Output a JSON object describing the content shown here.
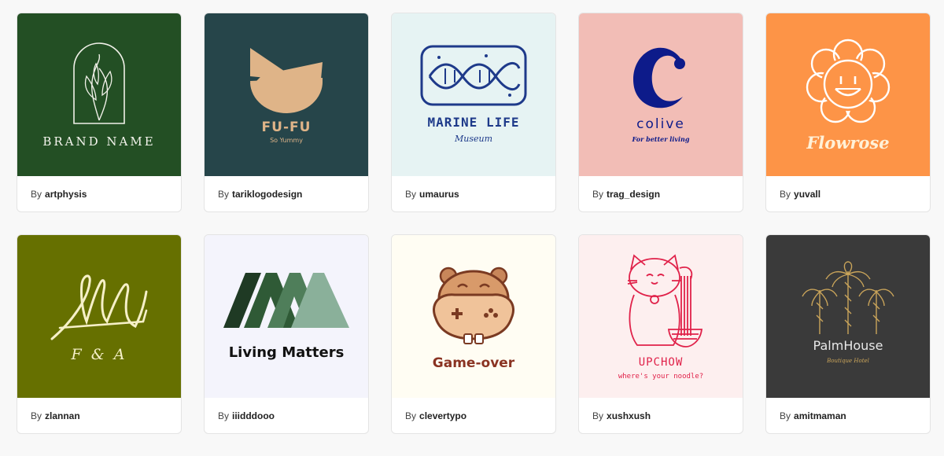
{
  "cards": [
    {
      "bg": "#234f24",
      "by_prefix": "By",
      "author": "artphysis",
      "logo_text": "BRAND NAME",
      "logo_sub": ""
    },
    {
      "bg": "#26454a",
      "by_prefix": "By",
      "author": "tariklogodesign",
      "logo_text": "FU-FU",
      "logo_sub": "So Yummy"
    },
    {
      "bg": "#e6f3f3",
      "by_prefix": "By",
      "author": "umaurus",
      "logo_text": "MARINE LIFE",
      "logo_sub": "Museum"
    },
    {
      "bg": "#f2bdb6",
      "by_prefix": "By",
      "author": "trag_design",
      "logo_text": "colive",
      "logo_sub": "For better living"
    },
    {
      "bg": "#fd9447",
      "by_prefix": "By",
      "author": "yuvall",
      "logo_text": "Flowrose",
      "logo_sub": ""
    },
    {
      "bg": "#667000",
      "by_prefix": "By",
      "author": "zlannan",
      "logo_text": "F & A",
      "logo_sub": ""
    },
    {
      "bg": "#f4f4fc",
      "by_prefix": "By",
      "author": "iiidddooo",
      "logo_text": "Living Matters",
      "logo_sub": ""
    },
    {
      "bg": "#fffdf3",
      "by_prefix": "By",
      "author": "clevertypo",
      "logo_text": "Game-over",
      "logo_sub": ""
    },
    {
      "bg": "#fdefef",
      "by_prefix": "By",
      "author": "xushxush",
      "logo_text": "UPCHOW",
      "logo_sub": "where's your noodle?"
    },
    {
      "bg": "#3a3a3a",
      "by_prefix": "By",
      "author": "amitmaman",
      "logo_text": "PalmHouse",
      "logo_sub": "Boutique Hotel"
    }
  ]
}
